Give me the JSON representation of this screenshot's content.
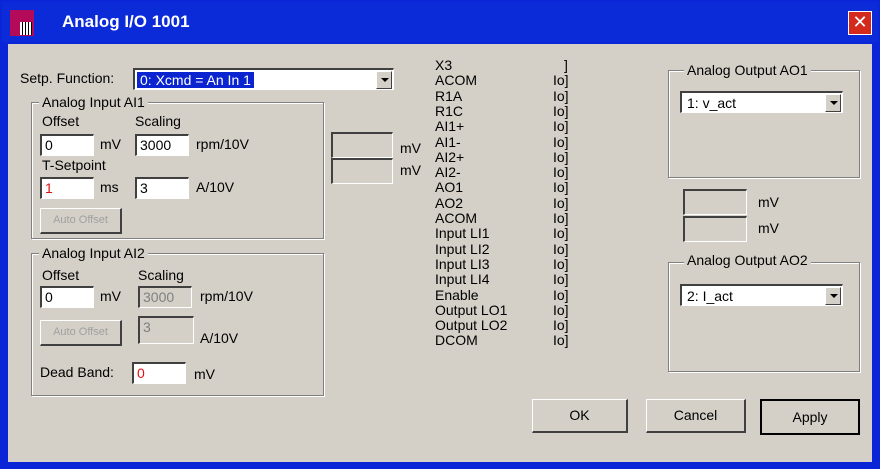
{
  "window": {
    "title": "Analog I/O 1001",
    "close_glyph": "✕",
    "icon_text": "Lnk\nInf"
  },
  "setpoint": {
    "label": "Setp. Function:",
    "value": "0: Xcmd =  An In 1"
  },
  "ai1": {
    "title": "Analog Input  AI1",
    "offset_label": "Offset",
    "offset_value": "0",
    "offset_unit": "mV",
    "scaling_label": "Scaling",
    "scaling_value": "3000",
    "scaling_unit": "rpm/10V",
    "tsetpoint_label": "T-Setpoint",
    "tsetpoint_value": "1",
    "tsetpoint_unit": "ms",
    "a_value": "3",
    "a_unit": "A/10V",
    "auto_offset": "Auto Offset"
  },
  "ai2": {
    "title": "Analog Input AI2",
    "offset_label": "Offset",
    "offset_value": "0",
    "offset_unit": "mV",
    "scaling_label": "Scaling",
    "scaling_value": "3000",
    "scaling_unit": "rpm/10V",
    "a_value": "3",
    "a_unit": "A/10V",
    "auto_offset": "Auto Offset"
  },
  "deadband": {
    "label": "Dead Band:",
    "value": "0",
    "unit": "mV"
  },
  "mid_fields": {
    "unit1": "mV",
    "unit2": "mV"
  },
  "pins": {
    "labels": [
      "X3",
      "ACOM",
      "R1A",
      "R1C",
      "AI1+",
      "AI1-",
      "AI2+",
      "AI2-",
      "AO1",
      "AO2",
      "ACOM",
      "Input LI1",
      "Input LI2",
      "Input LI3",
      "Input LI4",
      "Enable",
      "Output LO1",
      "Output LO2",
      "DCOM"
    ],
    "marks": [
      "]",
      "Io]",
      "Io]",
      "Io]",
      "Io]",
      "Io]",
      "Io]",
      "Io]",
      "Io]",
      "Io]",
      "Io]",
      "Io]",
      "Io]",
      "Io]",
      "Io]",
      "Io]",
      "Io]",
      "Io]",
      "Io]"
    ]
  },
  "ao1": {
    "title": "Analog Output AO1",
    "value": "1: v_act"
  },
  "ao2": {
    "title": "Analog Output AO2",
    "value": "2: I_act"
  },
  "right_fields": {
    "unit1": "mV",
    "unit2": "mV"
  },
  "buttons": {
    "ok": "OK",
    "cancel": "Cancel",
    "apply": "Apply"
  }
}
